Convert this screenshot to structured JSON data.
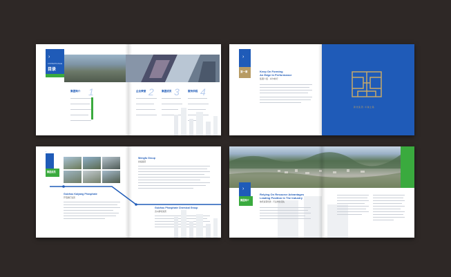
{
  "spread1": {
    "badge_title": "目录",
    "badge_sub": "CONTENTS PAGE",
    "sections": [
      {
        "num": "1",
        "title": "集团简介"
      },
      {
        "num": "2",
        "title": "企业荣誉"
      },
      {
        "num": "3",
        "title": "集团成员"
      },
      {
        "num": "4",
        "title": "服务供程"
      }
    ]
  },
  "spread2": {
    "chapter_label": "第一章",
    "title_line1": "Keep On Forming",
    "title_line2": "An Edge In Performance",
    "subtitle": "集团介绍 · 卓尔前行",
    "emblem_caption": "磷 化 集 团 · 卓 越 之 路"
  },
  "spread3": {
    "badge_title": "集团成员",
    "section_a_title": "Guizhou Kaiyang Phosphate",
    "section_a_sub": "开阳磷矿集团",
    "section_b_title": "Wengfu Group",
    "section_b_sub": "瓮福集团",
    "section_c_title": "Guizhou Phosphate Chemical Group",
    "section_c_sub": "贵州磷化集团"
  },
  "spread4": {
    "badge_title": "集团简介",
    "title_line1": "Relying On Resource Advantages",
    "title_line2": "Leading Position In The Industry",
    "subtitle": "依托资源优势 · 行业地位领先"
  },
  "colors": {
    "background": "#2e2826",
    "brand_blue": "#1f5bb8",
    "accent_green": "#3aaa3e",
    "gold": "#b79b64"
  }
}
